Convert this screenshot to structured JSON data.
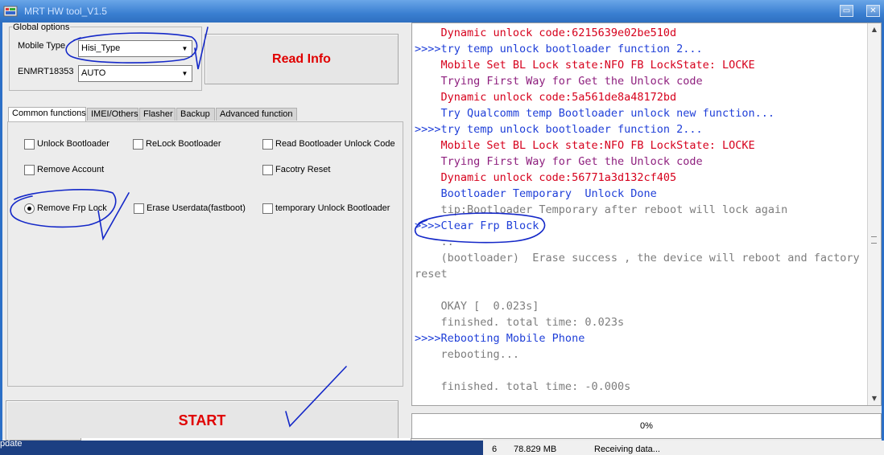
{
  "window": {
    "title": "MRT HW tool_V1.5",
    "minimize_glyph": "▭",
    "close_glyph": "✕"
  },
  "global_options": {
    "legend": "Global options",
    "mobile_type_label": "Mobile Type",
    "mobile_type_value": "Hisi_Type",
    "enmrt_label": "ENMRT18353",
    "enmrt_value": "AUTO",
    "dropdown_glyph": "▼"
  },
  "buttons": {
    "read_info": "Read Info",
    "start": "START"
  },
  "tabs": [
    {
      "label": "Common functions",
      "active": true
    },
    {
      "label": "IMEI/Others",
      "active": false
    },
    {
      "label": "Flasher",
      "active": false
    },
    {
      "label": "Backup",
      "active": false
    },
    {
      "label": "Advanced function",
      "active": false
    }
  ],
  "options": {
    "unlock_bootloader": {
      "label": "Unlock Bootloader",
      "checked": false
    },
    "relock_bootloader": {
      "label": "ReLock Bootloader",
      "checked": false
    },
    "read_bootloader_unlock_code": {
      "label": "Read Bootloader Unlock Code",
      "checked": false
    },
    "remove_account": {
      "label": "Remove Account",
      "checked": false
    },
    "factory_reset": {
      "label": "Facotry Reset",
      "checked": false
    },
    "remove_frp_lock": {
      "label": "Remove Frp Lock",
      "checked": true
    },
    "erase_userdata": {
      "label": "Erase Userdata(fastboot)",
      "checked": false
    },
    "temporary_unlock_bootloader": {
      "label": "temporary Unlock Bootloader",
      "checked": false
    }
  },
  "log": {
    "lines": [
      {
        "text": "    Dynamic unlock code:6215639e02be510d",
        "color": "#d6001c"
      },
      {
        "text": ">>>>try temp unlock bootloader function 2...",
        "color": "#1f3fd8"
      },
      {
        "text": "    Mobile Set BL Lock state:NFO FB LockState: LOCKE",
        "color": "#d6001c"
      },
      {
        "text": "    Trying First Way for Get the Unlock code",
        "color": "#8e1f7e"
      },
      {
        "text": "    Dynamic unlock code:5a561de8a48172bd",
        "color": "#d6001c"
      },
      {
        "text": "    Try Qualcomm temp Bootloader unlock new function...",
        "color": "#1f3fd8"
      },
      {
        "text": ">>>>try temp unlock bootloader function 2...",
        "color": "#1f3fd8"
      },
      {
        "text": "    Mobile Set BL Lock state:NFO FB LockState: LOCKE",
        "color": "#d6001c"
      },
      {
        "text": "    Trying First Way for Get the Unlock code",
        "color": "#8e1f7e"
      },
      {
        "text": "    Dynamic unlock code:56771a3d132cf405",
        "color": "#d6001c"
      },
      {
        "text": "    Bootloader Temporary  Unlock Done",
        "color": "#1f3fd8"
      },
      {
        "text": "    tip:Bootloader Temporary after reboot will lock again",
        "color": "#7d7d7d"
      },
      {
        "text": ">>>>Clear Frp Block",
        "color": "#1f3fd8"
      },
      {
        "text": "    ..",
        "color": "#7d7d7d"
      },
      {
        "text": "    (bootloader)  Erase success , the device will reboot and factory",
        "color": "#7d7d7d"
      },
      {
        "text": "reset",
        "color": "#7d7d7d"
      },
      {
        "text": "",
        "color": "#7d7d7d"
      },
      {
        "text": "    OKAY [  0.023s]",
        "color": "#7d7d7d"
      },
      {
        "text": "    finished. total time: 0.023s",
        "color": "#7d7d7d"
      },
      {
        "text": ">>>>Rebooting Mobile Phone",
        "color": "#1f3fd8"
      },
      {
        "text": "    rebooting...",
        "color": "#7d7d7d"
      },
      {
        "text": "",
        "color": "#7d7d7d"
      },
      {
        "text": "    finished. total time: -0.000s",
        "color": "#7d7d7d"
      }
    ],
    "scroll_up_glyph": "▲",
    "scroll_down_glyph": "▼"
  },
  "progress": {
    "percent_text": "0%",
    "value": 0
  },
  "background": {
    "left_fragment": "pdate",
    "row_index": "6",
    "row_size": "78.829  MB",
    "row_status": "Receiving data..."
  },
  "colors": {
    "button_text": "#e00000",
    "annotation_ink": "#1428c8",
    "titlebar": "#3a7fd1"
  }
}
